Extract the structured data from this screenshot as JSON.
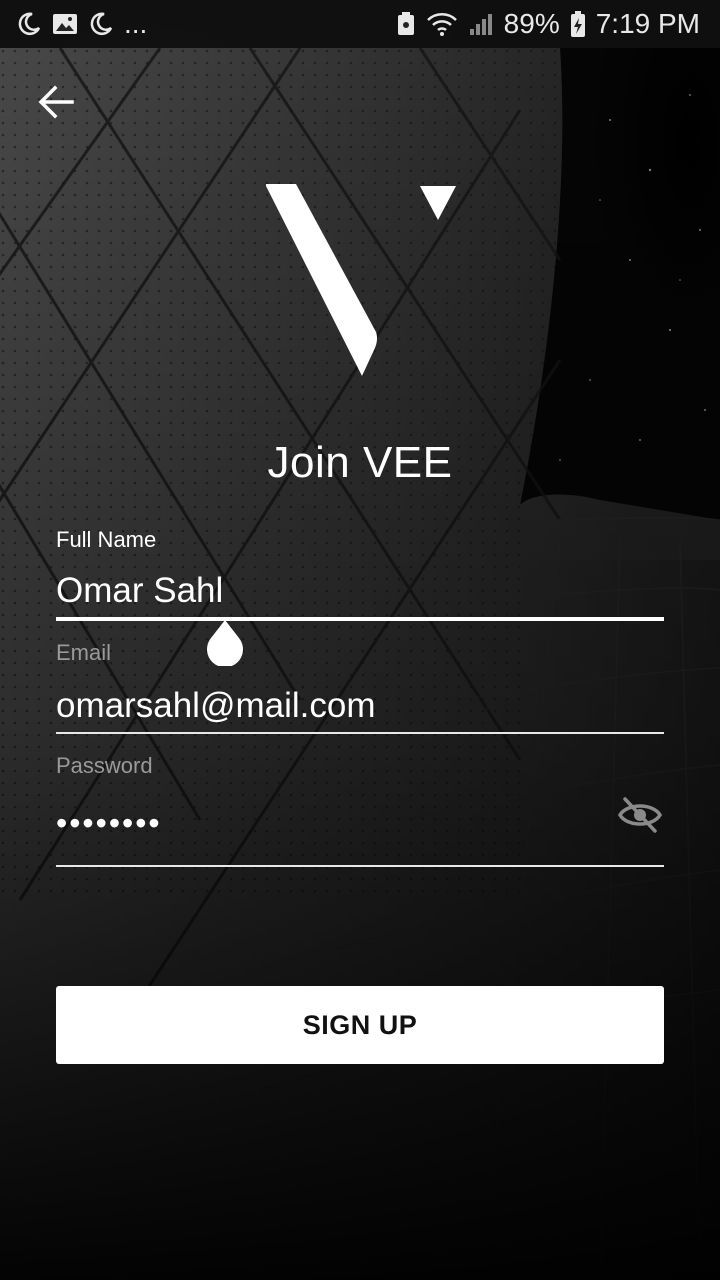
{
  "status_bar": {
    "more": "...",
    "battery": "89%",
    "time": "7:19 PM",
    "icons": [
      "moon-icon",
      "gallery-icon",
      "moon-icon",
      "nfc-icon",
      "wifi-icon",
      "signal-icon",
      "battery-charging-icon"
    ]
  },
  "header": {
    "back_icon": "arrow-left-icon"
  },
  "title": "Join VEE",
  "form": {
    "full_name": {
      "label": "Full Name",
      "value": "Omar Sahl"
    },
    "email": {
      "label": "Email",
      "value": "omarsahl@mail.com"
    },
    "password": {
      "label": "Password",
      "value": "••••••••",
      "toggle_icon": "eye-off-icon"
    }
  },
  "signup_label": "SIGN UP",
  "colors": {
    "accent": "#ffffff",
    "label_inactive": "#9a9a9a",
    "button_text": "#111111"
  }
}
